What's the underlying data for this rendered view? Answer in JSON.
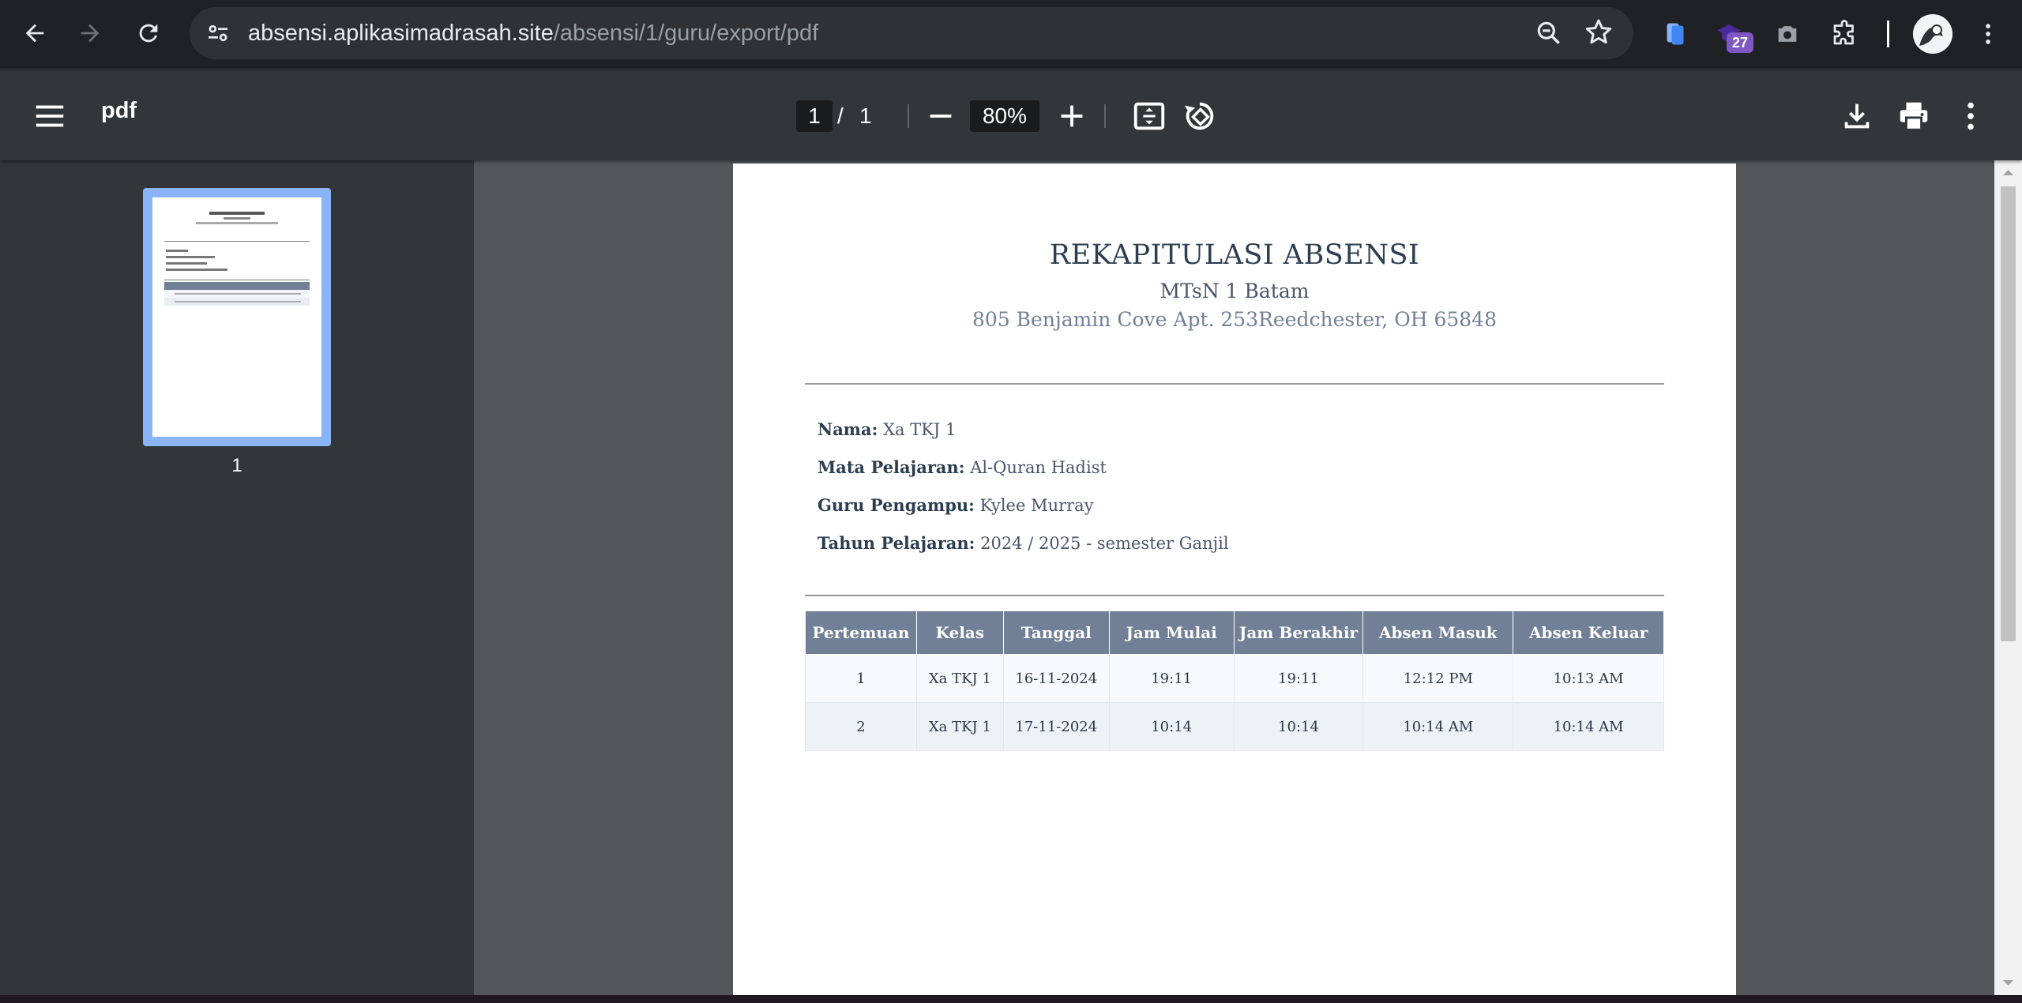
{
  "browser": {
    "url_host": "absensi.aplikasimadrasah.site",
    "url_path": "/absensi/1/guru/export/pdf",
    "extension_badge": "27"
  },
  "pdf_viewer": {
    "title": "pdf",
    "current_page": "1",
    "page_separator": "/",
    "total_pages": "1",
    "zoom": "80%",
    "thumbnail_label": "1"
  },
  "document": {
    "title": "REKAPITULASI ABSENSI",
    "school": "MTsN 1 Batam",
    "address": "805 Benjamin Cove Apt. 253Reedchester, OH 65848",
    "info": [
      {
        "label": "Nama:",
        "value": "Xa TKJ 1"
      },
      {
        "label": "Mata Pelajaran:",
        "value": "Al-Quran Hadist"
      },
      {
        "label": "Guru Pengampu:",
        "value": "Kylee Murray"
      },
      {
        "label": "Tahun Pelajaran:",
        "value": "2024 / 2025 - semester Ganjil"
      }
    ],
    "table": {
      "headers": [
        "Pertemuan",
        "Kelas",
        "Tanggal",
        "Jam Mulai",
        "Jam Berakhir",
        "Absen Masuk",
        "Absen Keluar"
      ],
      "rows": [
        [
          "1",
          "Xa TKJ 1",
          "16-11-2024",
          "19:11",
          "19:11",
          "12:12 PM",
          "10:13 AM"
        ],
        [
          "2",
          "Xa TKJ 1",
          "17-11-2024",
          "10:14",
          "10:14",
          "10:14 AM",
          "10:14 AM"
        ]
      ]
    }
  },
  "colors": {
    "browser_bg": "#202124",
    "viewer_toolbar": "#323639",
    "doc_area": "#525659",
    "table_header": "#718096",
    "thumbnail_highlight": "#8ab4f8"
  }
}
